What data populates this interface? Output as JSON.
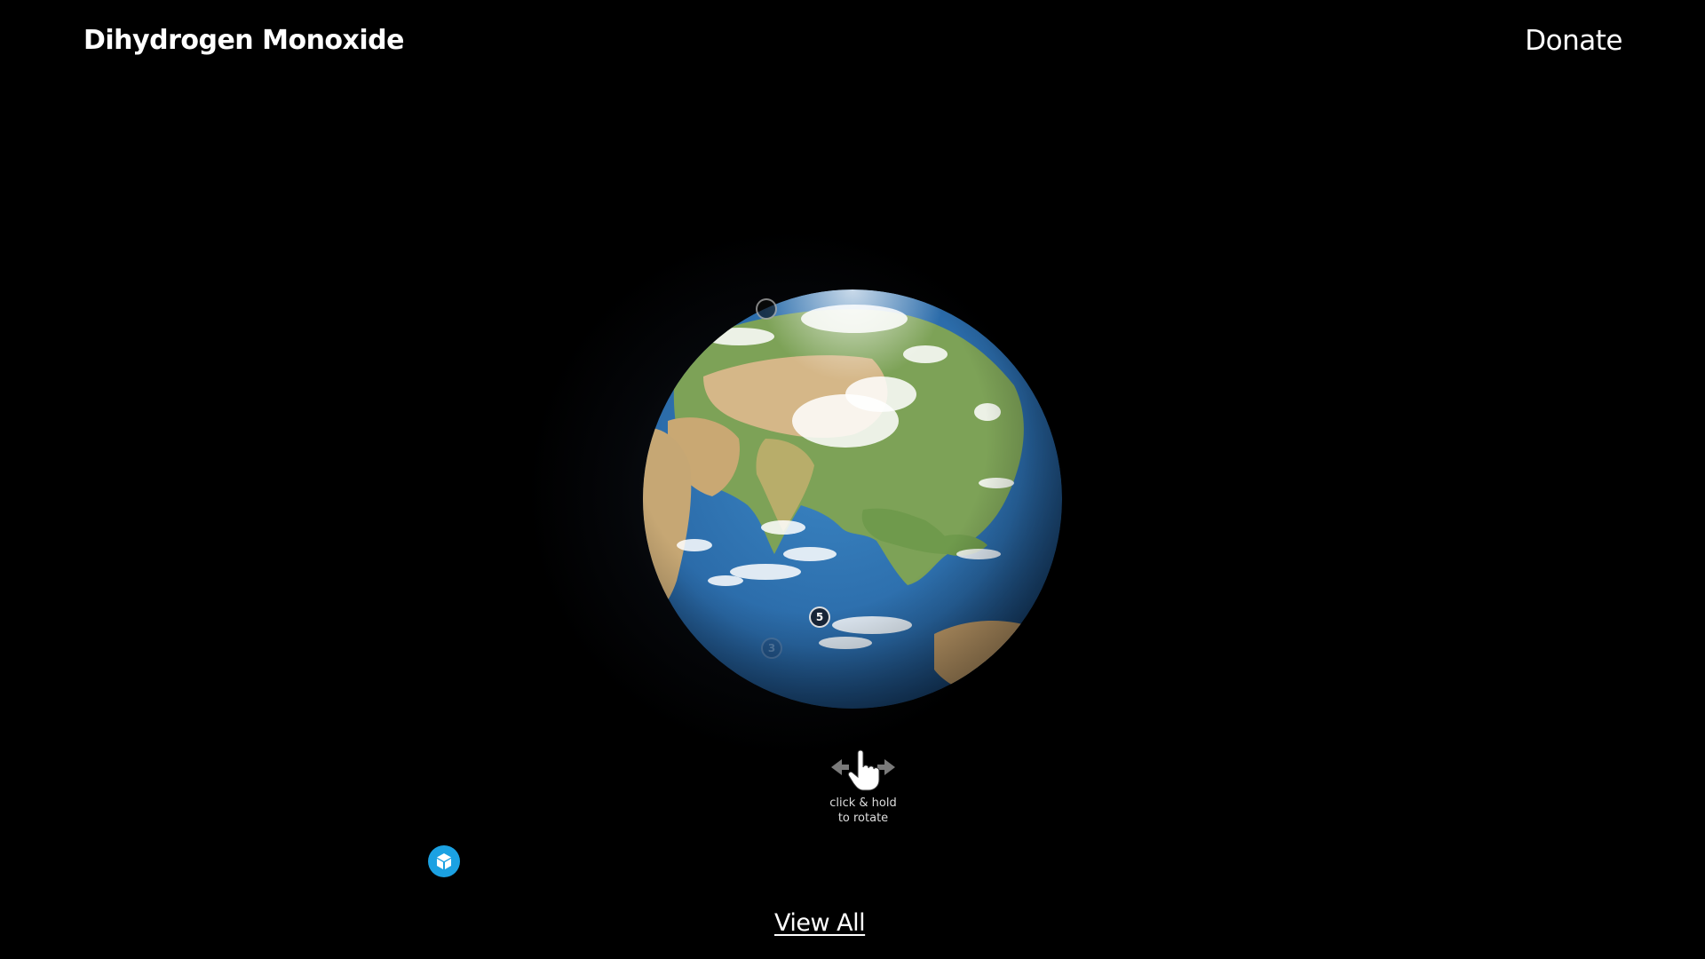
{
  "header": {
    "site_title": "Dihydrogen Monoxide",
    "donate_label": "Donate"
  },
  "viewer": {
    "hotspots": [
      {
        "label": ""
      },
      {
        "label": "5"
      },
      {
        "label": "3"
      }
    ],
    "rotate_hint": {
      "icon": "hand-drag-icon",
      "line1": "click & hold",
      "line2": "to rotate"
    },
    "logo_icon": "cube-icon",
    "colors": {
      "ocean": "#2a6fb0",
      "land": "#6e9a4a",
      "desert": "#d8b98a",
      "cloud": "#ffffff",
      "logo": "#1ba1e2"
    }
  },
  "footer": {
    "view_all_label": "View All"
  }
}
